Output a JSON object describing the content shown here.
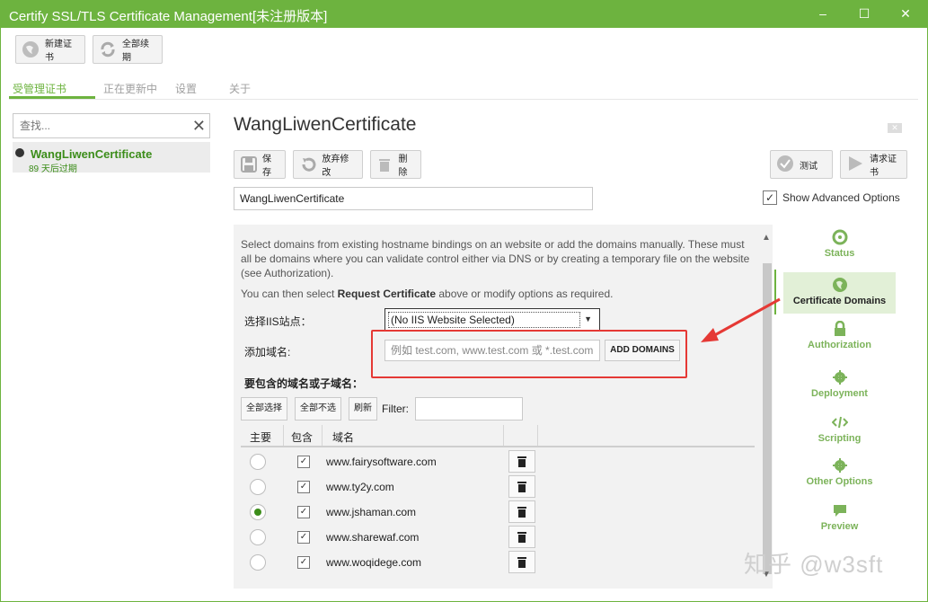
{
  "window": {
    "title": "Certify SSL/TLS Certificate Management[未注册版本]"
  },
  "toolbar": {
    "new_cert": "新建证书",
    "renew_all": "全部续期"
  },
  "tabs": [
    "受管理证书",
    "正在更新中",
    "设置",
    "关于"
  ],
  "search": {
    "placeholder": "查找..."
  },
  "cert_list": [
    {
      "name": "WangLiwenCertificate",
      "expiry": "89 天后过期"
    }
  ],
  "main": {
    "title": "WangLiwenCertificate",
    "save": "保存",
    "discard": "放弃修改",
    "delete": "删除",
    "test": "测试",
    "request": "请求证书",
    "name_value": "WangLiwenCertificate",
    "show_advanced": "Show Advanced Options"
  },
  "domains": {
    "description": "Select domains from existing hostname bindings on an website or add the domains manually. These must all be domains where you can validate control either via DNS or by creating a temporary file on the website (see Authorization).",
    "hint_prefix": "You can then select ",
    "hint_bold": "Request Certificate",
    "hint_suffix": " above or modify options as required.",
    "select_site_label": "选择IIS站点：",
    "select_site_value": "(No IIS Website Selected)",
    "add_domain_label": "添加域名:",
    "add_domain_placeholder": "例如 test.com, www.test.com 或 *.test.com",
    "add_domains_button": "ADD DOMAINS",
    "include_heading": "要包含的域名或子域名：",
    "select_all": "全部选择",
    "select_none": "全部不选",
    "refresh": "刷新",
    "filter_label": "Filter:",
    "columns": [
      "主要",
      "包含",
      "域名"
    ],
    "rows": [
      {
        "domain": "www.fairysoftware.com",
        "primary": false,
        "included": true
      },
      {
        "domain": "www.ty2y.com",
        "primary": false,
        "included": true
      },
      {
        "domain": "www.jshaman.com",
        "primary": true,
        "included": true
      },
      {
        "domain": "www.sharewaf.com",
        "primary": false,
        "included": true
      },
      {
        "domain": "www.woqidege.com",
        "primary": false,
        "included": true
      }
    ]
  },
  "nav": [
    "Status",
    "Certificate Domains",
    "Authorization",
    "Deployment",
    "Scripting",
    "Other Options",
    "Preview"
  ],
  "watermark": "知乎 @w3sft",
  "colors": {
    "accent": "#6db33f",
    "annotation": "#e53935"
  }
}
